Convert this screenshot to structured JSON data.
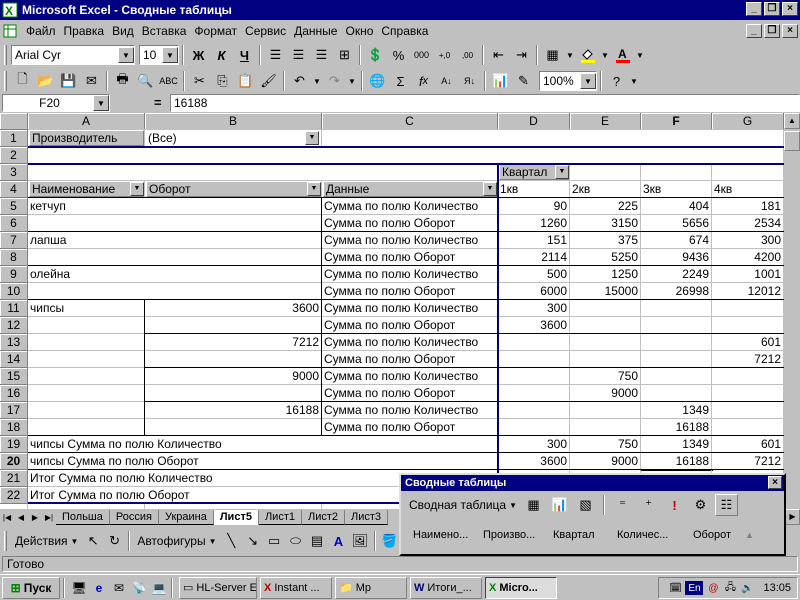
{
  "window": {
    "title": "Microsoft Excel - Сводные таблицы"
  },
  "menu": [
    "Файл",
    "Правка",
    "Вид",
    "Вставка",
    "Формат",
    "Сервис",
    "Данные",
    "Окно",
    "Справка"
  ],
  "format_toolbar": {
    "font": "Arial Cyr",
    "size": "10",
    "bold": "Ж",
    "italic": "К",
    "underline": "Ч"
  },
  "standard_toolbar": {
    "zoom": "100%"
  },
  "formula_bar": {
    "name_box": "F20",
    "equals": "=",
    "value": "16188"
  },
  "columns": [
    "A",
    "B",
    "C",
    "D",
    "E",
    "F",
    "G"
  ],
  "rows": [
    "1",
    "2",
    "3",
    "4",
    "5",
    "6",
    "7",
    "8",
    "9",
    "10",
    "11",
    "12",
    "13",
    "14",
    "15",
    "16",
    "17",
    "18",
    "19",
    "20",
    "21",
    "22"
  ],
  "pivot": {
    "page_field": "Производитель",
    "page_value": "(Все)",
    "col_field": "Квартал",
    "row_field_1": "Наименование",
    "row_field_2": "Оборот",
    "data_field": "Данные",
    "quarters": [
      "1кв",
      "2кв",
      "3кв",
      "4кв"
    ],
    "label_qty": "Сумма по полю Количество",
    "label_turn": "Сумма по полю Оборот",
    "products": {
      "ketchup": "кетчуп",
      "noodles": "лапша",
      "oleina": "олейна",
      "chips": "чипсы"
    },
    "ketchup": {
      "qty": [
        "90",
        "225",
        "404",
        "181"
      ],
      "turn": [
        "1260",
        "3150",
        "5656",
        "2534"
      ]
    },
    "noodles": {
      "qty": [
        "151",
        "375",
        "674",
        "300"
      ],
      "turn": [
        "2114",
        "5250",
        "9436",
        "4200"
      ]
    },
    "oleina": {
      "qty": [
        "500",
        "1250",
        "2249",
        "1001"
      ],
      "turn": [
        "6000",
        "15000",
        "26998",
        "12012"
      ]
    },
    "chips_sub": [
      {
        "turnover": "3600",
        "qty": [
          "300",
          "",
          "",
          ""
        ],
        "turn": [
          "3600",
          "",
          "",
          ""
        ]
      },
      {
        "turnover": "7212",
        "qty": [
          "",
          "",
          "",
          "601"
        ],
        "turn": [
          "",
          "",
          "",
          "7212"
        ]
      },
      {
        "turnover": "9000",
        "qty": [
          "",
          "750",
          "",
          ""
        ],
        "turn": [
          "",
          "9000",
          "",
          ""
        ]
      },
      {
        "turnover": "16188",
        "qty": [
          "",
          "",
          "1349",
          ""
        ],
        "turn": [
          "",
          "",
          "16188",
          ""
        ]
      }
    ],
    "chips_total_qty_label": "чипсы Сумма по полю Количество",
    "chips_total_turn_label": "чипсы Сумма по полю Оборот",
    "chips_total_qty": [
      "300",
      "750",
      "1349",
      "601"
    ],
    "chips_total_turn": [
      "3600",
      "9000",
      "16188",
      "7212"
    ],
    "grand_qty_label": "Итог Сумма по полю Количество",
    "grand_turn_label": "Итог Сумма по полю Оборот"
  },
  "sheet_tabs": [
    "Польша",
    "Россия",
    "Украина",
    "Лист5",
    "Лист1",
    "Лист2",
    "Лист3"
  ],
  "active_tab": "Лист5",
  "draw_toolbar": {
    "actions": "Действия",
    "autoshapes": "Автофигуры"
  },
  "status": "Готово",
  "pivot_toolbar": {
    "title": "Сводные таблицы",
    "menu": "Сводная таблица",
    "fields": [
      "Наимено...",
      "Произво...",
      "Квартал",
      "Количес...",
      "Оборот"
    ]
  },
  "taskbar": {
    "start": "Пуск",
    "tasks": [
      "HL-Server E...",
      "Instant ...",
      "Mp",
      "Итоги_...",
      "Micro..."
    ],
    "lang": "En",
    "clock": "13:05"
  },
  "colors": {
    "title_bar": "#000080",
    "pivot_border": "#000080",
    "face": "#c0c0c0"
  }
}
